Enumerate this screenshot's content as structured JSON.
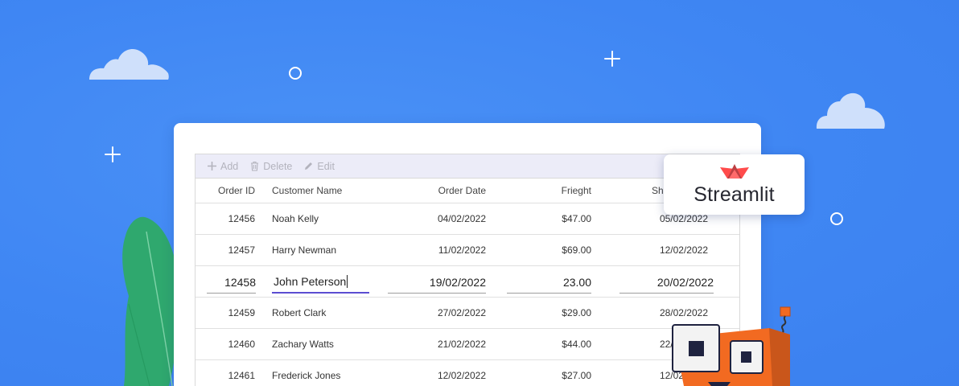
{
  "toolbar": {
    "add_label": "Add",
    "delete_label": "Delete",
    "edit_label": "Edit"
  },
  "grid": {
    "columns": {
      "order_id": "Order ID",
      "customer_name": "Customer Name",
      "order_date": "Order Date",
      "freight": "Frieght",
      "ship_date": "Shi"
    },
    "rows": [
      {
        "id": "12456",
        "name": "Noah Kelly",
        "date": "04/02/2022",
        "freight": "$47.00",
        "ship": "05/02/2022"
      },
      {
        "id": "12457",
        "name": "Harry Newman",
        "date": "11/02/2022",
        "freight": "$69.00",
        "ship": "12/02/2022"
      },
      {
        "id": "12459",
        "name": "Robert Clark",
        "date": "27/02/2022",
        "freight": "$29.00",
        "ship": "28/02/2022"
      },
      {
        "id": "12460",
        "name": "Zachary Watts",
        "date": "21/02/2022",
        "freight": "$44.00",
        "ship": "22/02/2022"
      },
      {
        "id": "12461",
        "name": "Frederick Jones",
        "date": "12/02/2022",
        "freight": "$27.00",
        "ship": "12/02/2022"
      }
    ],
    "edit_row": {
      "id": "12458",
      "name": "John Peterson",
      "date": "19/02/2022",
      "freight": "23.00",
      "ship": "20/02/2022"
    }
  },
  "badge": {
    "text": "Streamlit",
    "logo_color": "#ff4b4b"
  },
  "colors": {
    "background": "#3f86f3",
    "focus_underline": "#5b4dd1",
    "robot": "#f26a21",
    "leaf": "#2fa86e"
  },
  "icons": [
    "cloud-icon",
    "plus-icon",
    "ring-icon",
    "add-icon",
    "delete-icon",
    "edit-icon",
    "streamlit-logo",
    "robot-mascot",
    "leaf-illustration"
  ]
}
